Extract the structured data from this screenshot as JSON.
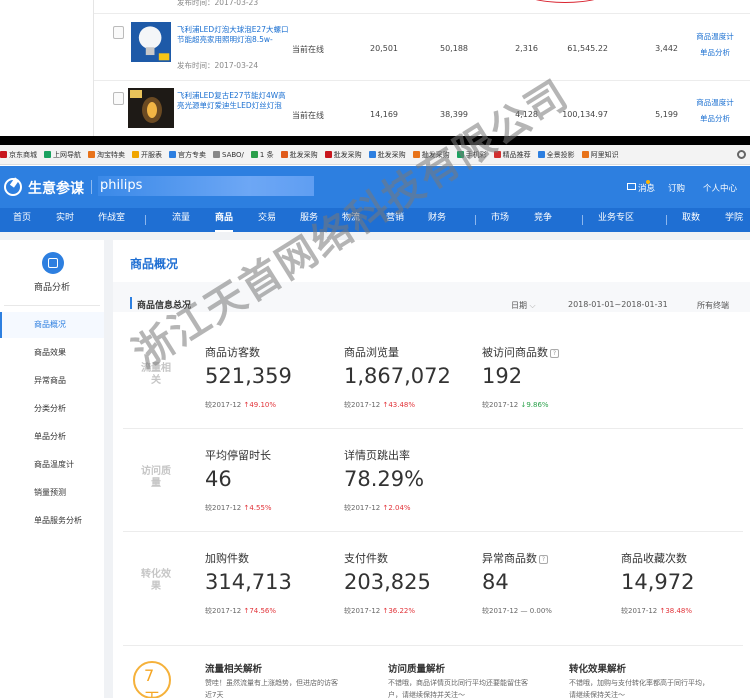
{
  "top_table": {
    "date_top": "发布时间：2017-03-23",
    "rows": [
      {
        "name": "飞利浦LED灯泡大球泡E27大螺口节能超亮家用照明灯泡8.5w-",
        "date": "发布时间：2017-03-24",
        "status": "当前在线",
        "c1": "20,501",
        "c2": "50,188",
        "c3": "2,316",
        "c4": "61,545.22",
        "c5": "3,442",
        "link1": "商品温度计",
        "link2": "单品分析"
      },
      {
        "name": "飞利浦LED复古E27节能灯4W高亮光源单灯爱迪生LED灯丝灯泡",
        "date": "",
        "status": "当前在线",
        "c1": "14,169",
        "c2": "38,399",
        "c3": "4,128",
        "c4": "100,134.97",
        "c5": "5,199",
        "link1": "商品温度计",
        "link2": "单品分析"
      }
    ]
  },
  "bookmarks": [
    "京东商城",
    "上网导航",
    "淘宝特卖",
    "开服表",
    "官方专卖",
    "SABO/",
    "1 条",
    "批发采购",
    "批发采购",
    "批发采购",
    "批发采购",
    "手机彩",
    "精品推荐",
    "全景投影",
    "阿里知识"
  ],
  "header": {
    "logo": "生意参谋",
    "shop": "philips",
    "message": "消息",
    "subscribe": "订购",
    "user": "个人中心"
  },
  "nav": {
    "items": [
      "首页",
      "实时",
      "作战室",
      "流量",
      "商品",
      "交易",
      "服务",
      "物流",
      "营销",
      "财务",
      "市场",
      "竞争",
      "业务专区",
      "取数",
      "学院"
    ],
    "active": "商品"
  },
  "sidebar": {
    "title": "商品分析",
    "items": [
      "商品概况",
      "商品效果",
      "异常商品",
      "分类分析",
      "单品分析",
      "商品温度计",
      "销量预测",
      "单品服务分析"
    ],
    "active": "商品概况"
  },
  "page": {
    "title": "商品概况",
    "section_title": "商品信息总况",
    "date_label": "日期",
    "date_range": "2018-01-01~2018-01-31",
    "terminal": "所有终端"
  },
  "groups": [
    {
      "cat": "流量相关",
      "metrics": [
        {
          "title": "商品访客数",
          "value": "521,359",
          "cmp": "较2017-12",
          "change": "49.10%",
          "dir": "up"
        },
        {
          "title": "商品浏览量",
          "value": "1,867,072",
          "cmp": "较2017-12",
          "change": "43.48%",
          "dir": "up"
        },
        {
          "title": "被访问商品数",
          "value": "192",
          "cmp": "较2017-12",
          "change": "9.86%",
          "dir": "down",
          "help": true
        }
      ]
    },
    {
      "cat": "访问质量",
      "metrics": [
        {
          "title": "平均停留时长",
          "value": "46",
          "cmp": "较2017-12",
          "change": "4.55%",
          "dir": "up"
        },
        {
          "title": "详情页跳出率",
          "value": "78.29%",
          "cmp": "较2017-12",
          "change": "2.04%",
          "dir": "up"
        }
      ]
    },
    {
      "cat": "转化效果",
      "metrics": [
        {
          "title": "加购件数",
          "value": "314,713",
          "cmp": "较2017-12",
          "change": "74.56%",
          "dir": "up"
        },
        {
          "title": "支付件数",
          "value": "203,825",
          "cmp": "较2017-12",
          "change": "36.22%",
          "dir": "up"
        },
        {
          "title": "异常商品数",
          "value": "84",
          "cmp": "较2017-12",
          "change": "0.00%",
          "dir": "flat",
          "help": true
        },
        {
          "title": "商品收藏次数",
          "value": "14,972",
          "cmp": "较2017-12",
          "change": "38.48%",
          "dir": "up"
        }
      ]
    }
  ],
  "analysis": {
    "badge": "7天",
    "cards": [
      {
        "title": "流量相关解析",
        "line1": "赞哇！虽然流量有上涨趋势，但进店的访客",
        "line2": "近7天"
      },
      {
        "title": "访问质量解析",
        "line1": "不错哦，商品详情页比同行平均还要能留住客",
        "line2": "户，请继续保持并关注～"
      },
      {
        "title": "转化效果解析",
        "line1": "不错哦，加购与支付转化率都高于同行平均，",
        "line2": "请继续保持关注～"
      }
    ]
  },
  "watermark": "浙江天首网络科技有限公司",
  "colors": {
    "brand": "#2d7fe0",
    "nav": "#1f6fd3",
    "up": "#e2343a",
    "down": "#2aa14a"
  }
}
